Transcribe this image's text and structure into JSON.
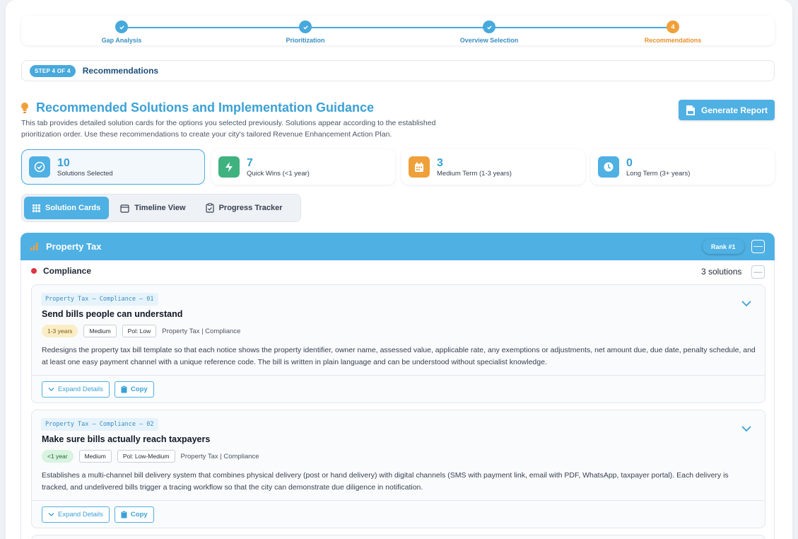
{
  "stepper": {
    "steps": [
      {
        "label": "Gap Analysis",
        "status": "done"
      },
      {
        "label": "Prioritization",
        "status": "done"
      },
      {
        "label": "Overview Selection",
        "status": "done"
      },
      {
        "label": "Recommendations",
        "status": "current",
        "number": "4"
      }
    ]
  },
  "stepbar": {
    "badge": "STEP 4 OF 4",
    "title": "Recommendations"
  },
  "header": {
    "title": "Recommended Solutions and Implementation Guidance",
    "description": "This tab provides detailed solution cards for the options you selected previously. Solutions appear according to the established prioritization order. Use these recommendations to create your city's tailored Revenue Enhancement Action Plan.",
    "generate_button": "Generate Report"
  },
  "stats": [
    {
      "value": "10",
      "label": "Solutions Selected",
      "icon": "check-circle-icon",
      "color": "#4fb0e3"
    },
    {
      "value": "7",
      "label": "Quick Wins (<1 year)",
      "icon": "bolt-icon",
      "color": "#3fb27f"
    },
    {
      "value": "3",
      "label": "Medium Term (1-3 years)",
      "icon": "calendar-icon",
      "color": "#f0a03a"
    },
    {
      "value": "0",
      "label": "Long Term (3+ years)",
      "icon": "clock-icon",
      "color": "#4fb0e3"
    }
  ],
  "tabs": [
    {
      "label": "Solution Cards",
      "icon": "grid-icon",
      "active": true
    },
    {
      "label": "Timeline View",
      "icon": "calendar-outline-icon",
      "active": false
    },
    {
      "label": "Progress Tracker",
      "icon": "clipboard-icon",
      "active": false
    }
  ],
  "category": {
    "title": "Property Tax",
    "rank": "Rank #1",
    "collapse": "—"
  },
  "subcategory": {
    "name": "Compliance",
    "count": "3 solutions",
    "collapse": "—"
  },
  "cards": [
    {
      "code": "Property Tax – Compliance – 01",
      "title": "Send bills people can understand",
      "timeframe": "1-3 years",
      "effort": "Medium",
      "political": "Pol: Low",
      "path": "Property Tax | Compliance",
      "description": "Redesigns the property tax bill template so that each notice shows the property identifier, owner name, assessed value, applicable rate, any exemptions or adjustments, net amount due, due date, penalty schedule, and at least one easy payment channel with a unique reference code. The bill is written in plain language and can be understood without specialist knowledge.",
      "expand": "Expand Details",
      "copy": "Copy"
    },
    {
      "code": "Property Tax – Compliance – 02",
      "title": "Make sure bills actually reach taxpayers",
      "timeframe": "<1 year",
      "effort": "Medium",
      "political": "Pol: Low-Medium",
      "path": "Property Tax | Compliance",
      "description": "Establishes a multi-channel bill delivery system that combines physical delivery (post or hand delivery) with digital channels (SMS with payment link, email with PDF, WhatsApp, taxpayer portal). Each delivery is tracked, and undelivered bills trigger a tracing workflow so that the city can demonstrate due diligence in notification.",
      "expand": "Expand Details",
      "copy": "Copy"
    }
  ]
}
